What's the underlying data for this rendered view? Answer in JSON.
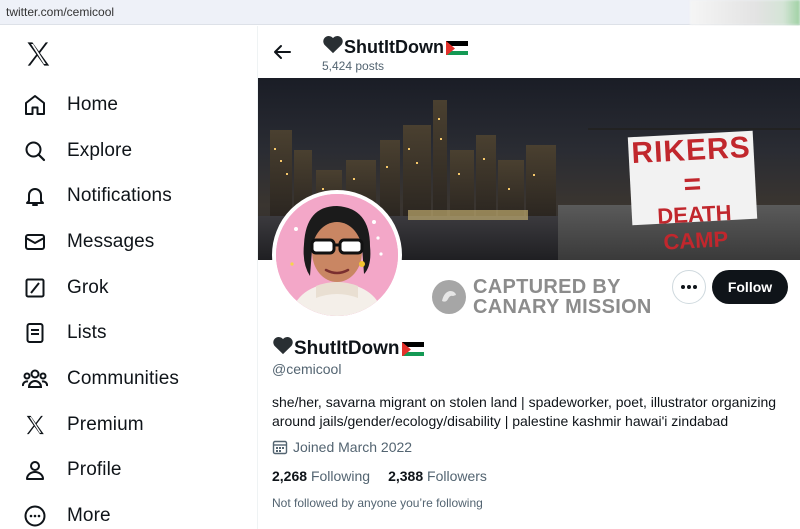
{
  "browser": {
    "url": "twitter.com/cemicool"
  },
  "sidebar": {
    "items": [
      {
        "label": "Home",
        "icon": "home-icon"
      },
      {
        "label": "Explore",
        "icon": "search-icon"
      },
      {
        "label": "Notifications",
        "icon": "bell-icon"
      },
      {
        "label": "Messages",
        "icon": "envelope-icon"
      },
      {
        "label": "Grok",
        "icon": "grok-icon"
      },
      {
        "label": "Lists",
        "icon": "list-icon"
      },
      {
        "label": "Communities",
        "icon": "people-icon"
      },
      {
        "label": "Premium",
        "icon": "x-logo-icon"
      },
      {
        "label": "Profile",
        "icon": "person-icon"
      },
      {
        "label": "More",
        "icon": "more-circle-icon"
      }
    ]
  },
  "header": {
    "title": "ShutItDown",
    "post_count": "5,424 posts"
  },
  "banner": {
    "sign_line1": "RIKERS =",
    "sign_line2": "DEATH CAMP"
  },
  "watermark": {
    "line1": "CAPTURED BY",
    "line2": "CANARY MISSION"
  },
  "actions": {
    "follow_label": "Follow"
  },
  "profile": {
    "display_name": "ShutItDown",
    "handle": "@cemicool",
    "bio": "she/her, savarna migrant on stolen land | spadeworker, poet, illustrator organizing around jails/gender/ecology/disability | palestine kashmir hawai'i zindabad",
    "joined": "Joined March 2022",
    "following_count": "2,268",
    "following_label": "Following",
    "followers_count": "2,388",
    "followers_label": "Followers",
    "not_followed": "Not followed by anyone you’re following"
  },
  "colors": {
    "text": "#0f1419",
    "muted": "#536471",
    "follow_bg": "#0f1419",
    "border": "#cfd9de"
  }
}
